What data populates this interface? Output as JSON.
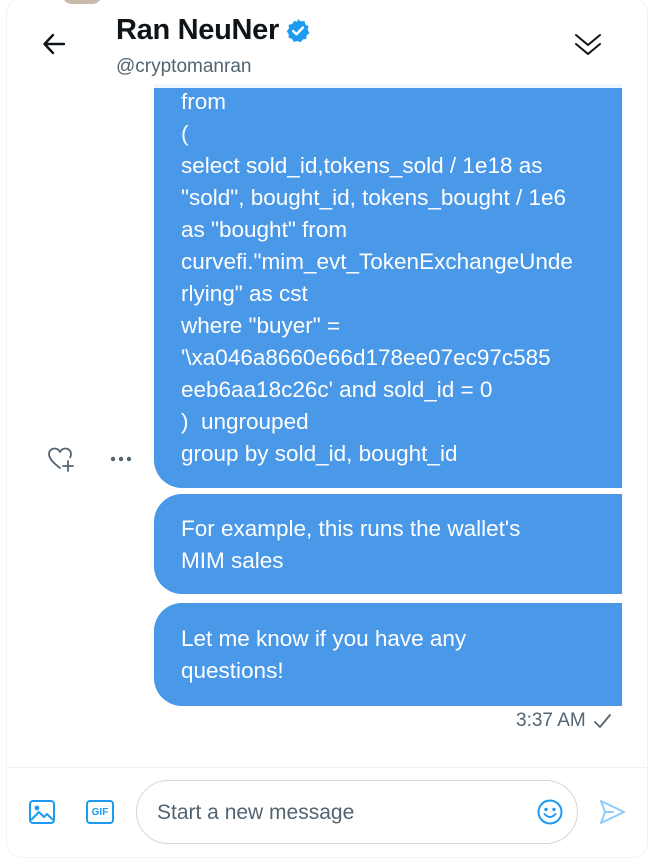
{
  "header": {
    "name": "Ran NeuNer",
    "handle": "@cryptomanran"
  },
  "messages": [
    {
      "lines": [
        "from",
        "(",
        "select sold_id,tokens_sold / 1e18 as",
        "\"sold\", bought_id, tokens_bought / 1e6",
        "as \"bought\" from",
        "curvefi.\"mim_evt_TokenExchangeUnde",
        "rlying\" as cst",
        "where \"buyer\" =",
        "'\\xa046a8660e66d178ee07ec97c585",
        "eeb6aa18c26c' and sold_id = 0",
        ")  ungrouped",
        "group by sold_id, bought_id"
      ]
    },
    {
      "lines": [
        "For example, this runs the wallet's",
        "MIM sales"
      ]
    },
    {
      "lines": [
        "Let me know if you have any",
        "questions!"
      ]
    }
  ],
  "timestamp": "3:37 AM",
  "composer": {
    "placeholder": "Start a new message",
    "gif_label": "GIF"
  },
  "colors": {
    "bubble": "#4a98e8",
    "accent": "#1d9bf0",
    "send_disabled": "#8ecdf8"
  },
  "icons": {
    "back": "arrow-left-icon",
    "verified": "verified-badge-icon",
    "collapse": "double-chevron-down-icon",
    "react": "heart-plus-icon",
    "more": "more-dots-icon",
    "read": "checkmark-icon",
    "media": "image-icon",
    "gif": "gif-icon",
    "emoji": "emoji-icon",
    "send": "send-icon"
  }
}
